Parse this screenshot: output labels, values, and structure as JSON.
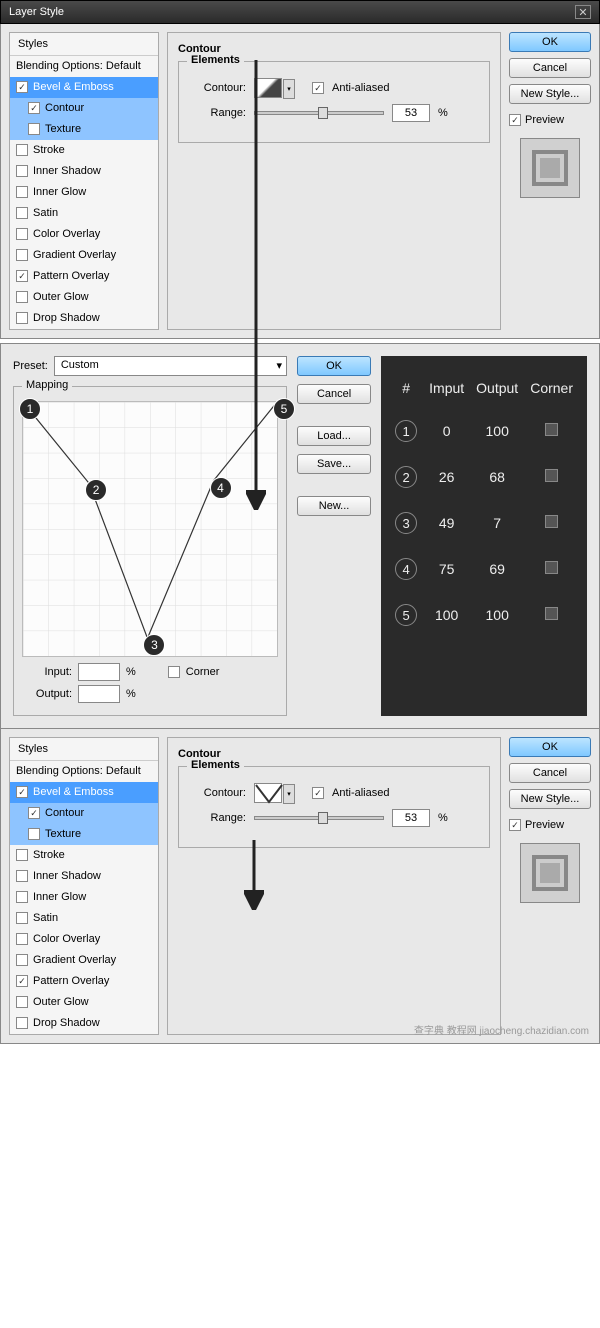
{
  "window": {
    "title": "Layer Style"
  },
  "styles_panel": {
    "header": "Styles",
    "blending": "Blending Options: Default",
    "items": [
      {
        "label": "Bevel & Emboss",
        "checked": true,
        "selected": true
      },
      {
        "label": "Contour",
        "checked": true,
        "sub": true,
        "active": true
      },
      {
        "label": "Texture",
        "checked": false,
        "sub": true,
        "active": true
      },
      {
        "label": "Stroke",
        "checked": false
      },
      {
        "label": "Inner Shadow",
        "checked": false
      },
      {
        "label": "Inner Glow",
        "checked": false
      },
      {
        "label": "Satin",
        "checked": false
      },
      {
        "label": "Color Overlay",
        "checked": false
      },
      {
        "label": "Gradient Overlay",
        "checked": false
      },
      {
        "label": "Pattern Overlay",
        "checked": true
      },
      {
        "label": "Outer Glow",
        "checked": false
      },
      {
        "label": "Drop Shadow",
        "checked": false
      }
    ]
  },
  "contour_group": {
    "title": "Contour",
    "elements_title": "Elements",
    "contour_label": "Contour:",
    "anti_aliased": "Anti-aliased",
    "range_label": "Range:",
    "range_value": "53",
    "range_pct": "%"
  },
  "right": {
    "ok": "OK",
    "cancel": "Cancel",
    "new_style": "New Style...",
    "preview": "Preview"
  },
  "editor": {
    "preset_label": "Preset:",
    "preset_value": "Custom",
    "mapping": "Mapping",
    "input_label": "Input:",
    "output_label": "Output:",
    "pct": "%",
    "corner": "Corner",
    "buttons": {
      "ok": "OK",
      "cancel": "Cancel",
      "load": "Load...",
      "save": "Save...",
      "new": "New..."
    }
  },
  "chart_data": {
    "type": "line",
    "title": "Mapping",
    "xlabel": "Input",
    "ylabel": "Output",
    "xlim": [
      0,
      100
    ],
    "ylim": [
      0,
      100
    ],
    "x": [
      0,
      26,
      49,
      75,
      100
    ],
    "y": [
      100,
      68,
      7,
      69,
      100
    ],
    "corner": [
      false,
      false,
      false,
      false,
      false
    ],
    "points": [
      "1",
      "2",
      "3",
      "4",
      "5"
    ]
  },
  "table": {
    "headers": [
      "#",
      "Imput",
      "Output",
      "Corner"
    ],
    "rows": [
      {
        "n": "1",
        "input": "0",
        "output": "100"
      },
      {
        "n": "2",
        "input": "26",
        "output": "68"
      },
      {
        "n": "3",
        "input": "49",
        "output": "7"
      },
      {
        "n": "4",
        "input": "75",
        "output": "69"
      },
      {
        "n": "5",
        "input": "100",
        "output": "100"
      }
    ]
  },
  "watermark": "查字典 教程网 jiaocheng.chazidian.com"
}
